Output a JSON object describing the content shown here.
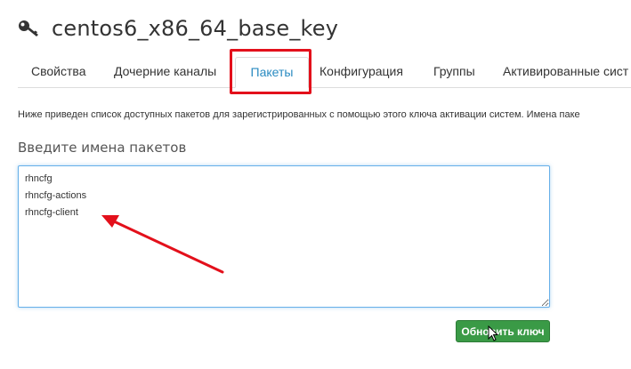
{
  "header": {
    "icon": "key-icon",
    "title": "centos6_x86_64_base_key"
  },
  "tabs": [
    {
      "label": "Свойства",
      "active": false
    },
    {
      "label": "Дочерние каналы",
      "active": false
    },
    {
      "label": "Пакеты",
      "active": true
    },
    {
      "label": "Конфигурация",
      "active": false
    },
    {
      "label": "Группы",
      "active": false
    },
    {
      "label": "Активированные сист",
      "active": false
    }
  ],
  "main": {
    "description": "Ниже приведен список доступных пакетов для зарегистрированных с помощью этого ключа активации систем. Имена паке",
    "packages_label": "Введите имена пакетов",
    "packages_value": "rhncfg\nrhncfg-actions\nrhncfg-client",
    "update_button": "Обновить ключ"
  },
  "colors": {
    "accent": "#2a8bc1",
    "highlight": "#e3101b",
    "button": "#3a9a46"
  }
}
